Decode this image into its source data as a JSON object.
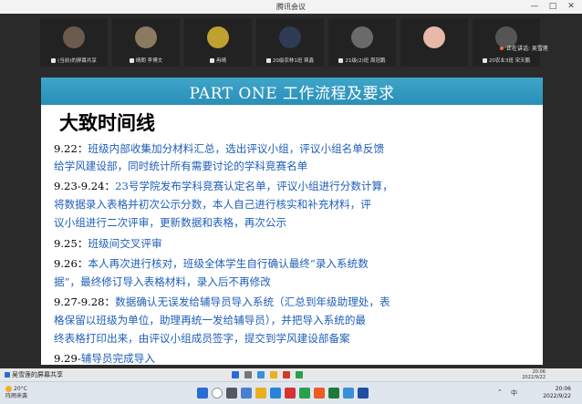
{
  "window": {
    "title": "腾讯会议",
    "minimize": "—",
    "maximize": "□",
    "close": "✕"
  },
  "participants": [
    {
      "name": "(当前)的屏幕共享",
      "color": "#6b5a4e"
    },
    {
      "name": "晴朗 李博文",
      "color": "#8a7a60"
    },
    {
      "name": "冉晴",
      "color": "#c0a030"
    },
    {
      "name": "20级农林1班 蒋鑫",
      "color": "#2f3a55"
    },
    {
      "name": "21级(2)班 周冠鹏",
      "color": "#6a6a6a"
    },
    {
      "name": "",
      "color": "#e8b8a8"
    },
    {
      "name": "20农业3班 宋天鹏",
      "color": "#555"
    }
  ],
  "speaking": {
    "label": "正在讲话: 吴雪莲"
  },
  "slide": {
    "banner": "PART ONE 工作流程及要求",
    "heading": "大致时间线",
    "lines": [
      {
        "k": "9.22：",
        "t": "班级内部收集加分材料汇总，选出评议小组，评议小组名单反馈"
      },
      {
        "k": "",
        "t": "给学风建设部，同时统计所有需要讨论的学科竞赛名单"
      },
      {
        "k": "9.23-9.24：",
        "t": "23号学院发布学科竞赛认定名单，评议小组进行分数计算，"
      },
      {
        "k": "",
        "t": "将数据录入表格并初次公示分数，本人自己进行核实和补充材料，评"
      },
      {
        "k": "",
        "t": "议小组进行二次评审，更新数据和表格，再次公示"
      },
      {
        "k": "9.25：",
        "t": "班级间交叉评审"
      },
      {
        "k": "9.26：",
        "t": "本人再次进行核对，班级全体学生自行确认最终“录入系统数"
      },
      {
        "k": "",
        "t": "据”，最终修订导入表格材料，录入后不再修改"
      },
      {
        "k": "9.27-9.28：",
        "t": "数据确认无误发给辅导员导入系统（汇总到年级助理处，表"
      },
      {
        "k": "",
        "t": "格保留以班级为单位，助理再统一发给辅导员），并把导入系统的最"
      },
      {
        "k": "",
        "t": "终表格打印出来，由评议小组成员签字，提交到学风建设部备案"
      },
      {
        "k": "9.29-",
        "t": "辅导员完成导入"
      }
    ]
  },
  "sharebar": {
    "label": "吴雪莲的屏幕共享"
  },
  "taskbar": {
    "weather_temp": "20°C",
    "weather_desc": "阵雨来袭",
    "inner_time": "20:06",
    "inner_date": "2022/9/22",
    "time": "20:06",
    "date": "2022/9/22",
    "lang": "中"
  }
}
